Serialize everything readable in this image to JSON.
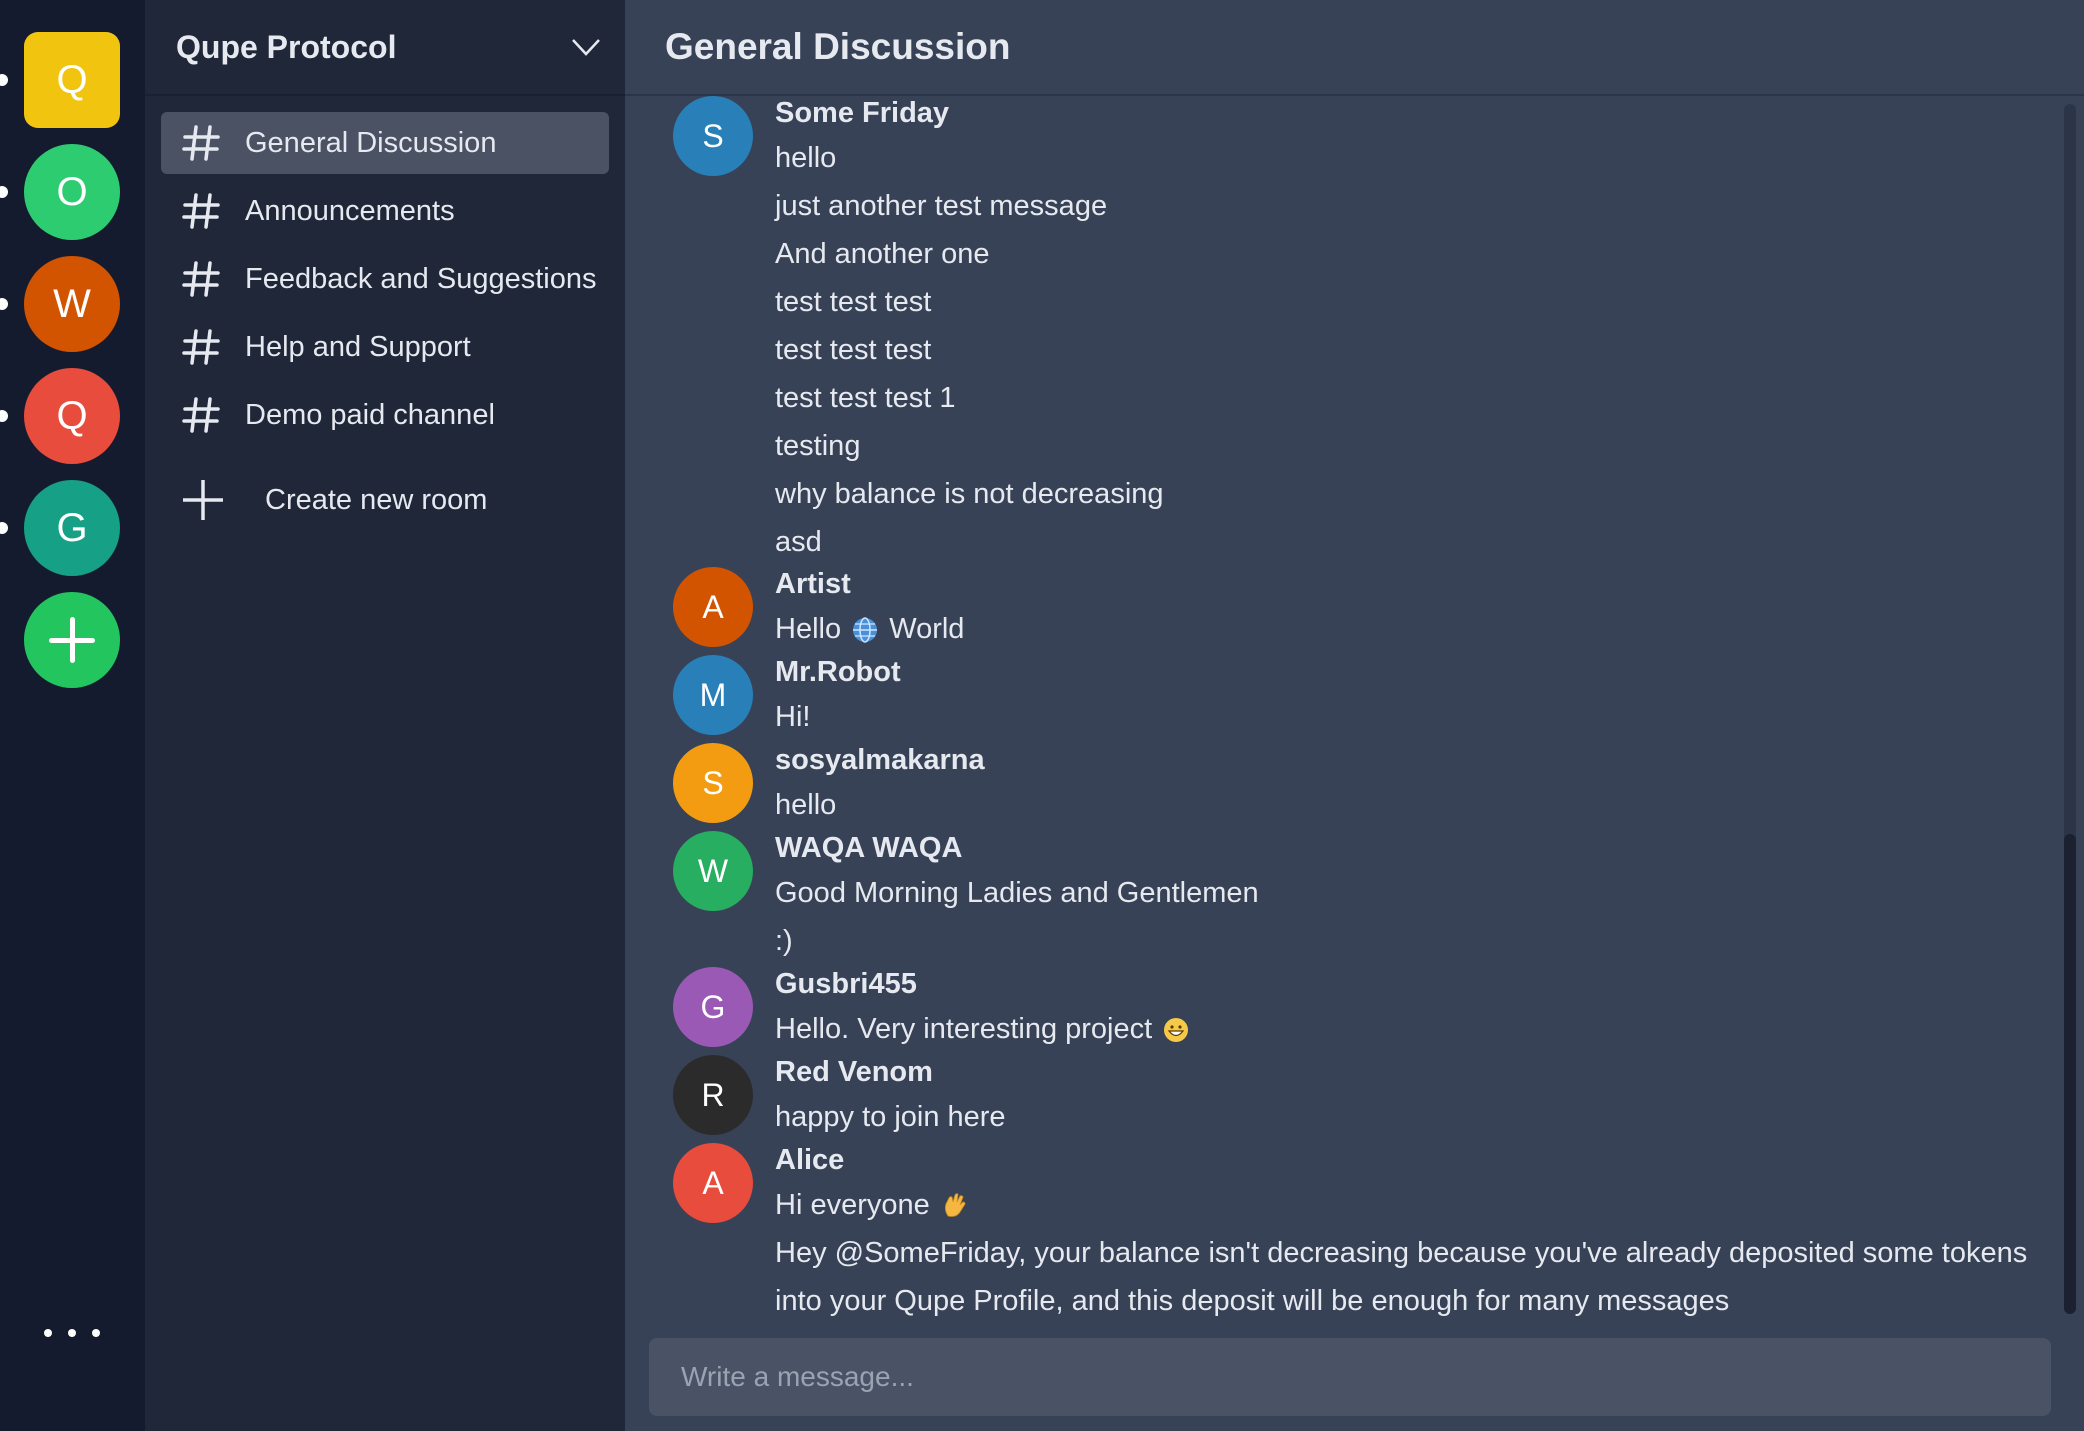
{
  "colors": {
    "rail_bg": "#151b2e",
    "sidebar_bg": "#1f2738",
    "main_bg": "#374256",
    "active_channel_bg": "#4a5263",
    "text": "#e6e9ef"
  },
  "servers": [
    {
      "letter": "Q",
      "color": "#f1c40f",
      "active": true
    },
    {
      "letter": "O",
      "color": "#2ecc71"
    },
    {
      "letter": "W",
      "color": "#d35400"
    },
    {
      "letter": "Q",
      "color": "#e74c3c"
    },
    {
      "letter": "G",
      "color": "#16a085"
    }
  ],
  "add_server": {
    "icon": "plus-icon",
    "color": "#22c55e"
  },
  "more": {
    "icon": "more-horizontal-icon"
  },
  "sidebar": {
    "title": "Qupe Protocol",
    "channels": [
      {
        "label": "General Discussion",
        "active": true
      },
      {
        "label": "Announcements"
      },
      {
        "label": "Feedback and Suggestions"
      },
      {
        "label": "Help and Support"
      },
      {
        "label": "Demo paid channel"
      }
    ],
    "create_room_label": "Create new room"
  },
  "main": {
    "title": "General Discussion",
    "composer_placeholder": "Write a message...",
    "messages": [
      {
        "author": "Some Friday",
        "initial": "S",
        "color": "#2980b9",
        "lines": [
          "hello",
          "just another test message",
          "And another one",
          "test test test",
          "test test test",
          "test test test 1",
          "testing",
          "why balance is not decreasing",
          "asd"
        ]
      },
      {
        "author": "Artist",
        "initial": "A",
        "color": "#d35400",
        "lines": [
          "Hello",
          "World"
        ],
        "emoji": "globe-emoji"
      },
      {
        "author": "Mr.Robot",
        "initial": "M",
        "color": "#2980b9",
        "lines": [
          "Hi!"
        ]
      },
      {
        "author": "sosyalmakarna",
        "initial": "S",
        "color": "#f39c12",
        "lines": [
          "hello"
        ]
      },
      {
        "author": "WAQA WAQA",
        "initial": "W",
        "color": "#27ae60",
        "lines": [
          "Good Morning Ladies and Gentlemen",
          ":)"
        ]
      },
      {
        "author": "Gusbri455",
        "initial": "G",
        "color": "#9b59b6",
        "lines": [
          "Hello. Very interesting project"
        ],
        "emoji": "grinning-face-emoji"
      },
      {
        "author": "Red Venom",
        "initial": "R",
        "color": "#2b2b2b",
        "lines": [
          "happy to join here"
        ]
      },
      {
        "author": "Alice",
        "initial": "A",
        "color": "#e74c3c",
        "lines": [
          "Hi everyone",
          "Hey @SomeFriday, your balance isn't decreasing because you've already deposited some tokens",
          "into your Qupe Profile, and this deposit will be enough for many messages"
        ],
        "emoji": "waving-hand-emoji"
      }
    ]
  }
}
